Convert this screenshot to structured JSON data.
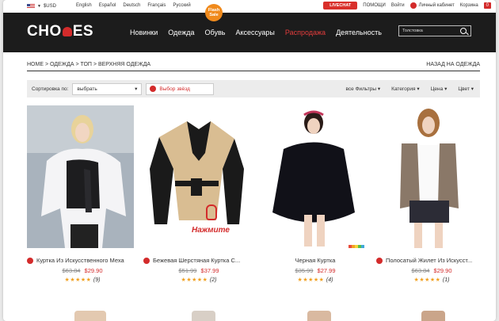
{
  "topbar": {
    "currency": "$USD",
    "languages": [
      "English",
      "Español",
      "Deutsch",
      "Français",
      "Русский"
    ],
    "livechat": "LIVECHAT",
    "help": "ПОМОЩИ",
    "login": "Войти",
    "cabinet": "Личный кабинет",
    "cart": "Корзина",
    "cart_count": "0"
  },
  "header": {
    "logo_left": "CHO",
    "logo_right": "ES",
    "nav": [
      "Новинки",
      "Одежда",
      "Обувь",
      "Аксессуары",
      "Распродажа",
      "Деятельность"
    ],
    "search_placeholder": "Толстовка"
  },
  "breadcrumb": {
    "path": "HOME > ОДЕЖДА > ТОП > ВЕРХНЯЯ ОДЕЖДА",
    "back": "НАЗАД НА ОДЕЖДА"
  },
  "filters": {
    "sort_label": "Сортировка по:",
    "sort_value": "выбрать",
    "star_select": "Выбор звёзд",
    "all_filters": "все Фильтры",
    "category": "Категория",
    "price": "Цена",
    "color": "Цвет"
  },
  "badges": {
    "flash_line1": "Flash",
    "flash_line2": "Sale",
    "tap": "Нажмите"
  },
  "products": [
    {
      "name": "Куртка Из Искусственного Меха",
      "old_price": "$63.84",
      "new_price": "$29.90",
      "stars": "★★★★★",
      "count": "(9)"
    },
    {
      "name": "Бежевая Шерстяная Куртка С...",
      "old_price": "$51.99",
      "new_price": "$37.99",
      "stars": "★★★★★",
      "count": "(2)"
    },
    {
      "name": "Черная Куртка",
      "old_price": "$35.99",
      "new_price": "$27.99",
      "stars": "★★★★★",
      "count": "(4)"
    },
    {
      "name": "Полосатый Жилет Из Искусст...",
      "old_price": "$63.84",
      "new_price": "$29.90",
      "stars": "★★★★★",
      "count": "(1)"
    }
  ],
  "colors": {
    "accent": "#d32b2b",
    "header_bg": "#1c1c1c",
    "star": "#f0a020",
    "flash": "#f08a1c"
  }
}
